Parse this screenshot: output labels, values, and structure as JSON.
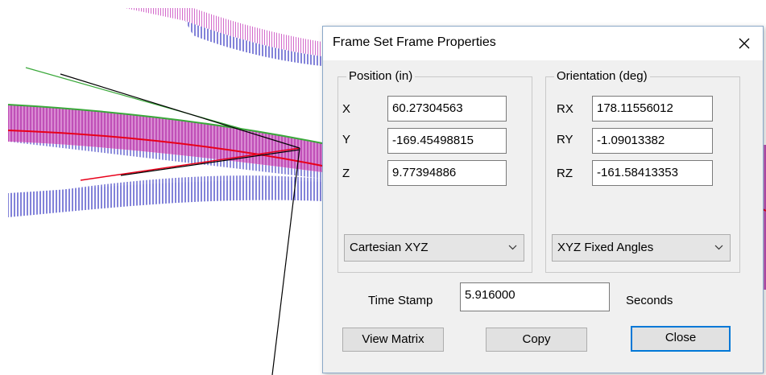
{
  "dialog": {
    "title": "Frame Set Frame Properties",
    "position_group": {
      "label": "Position (in)",
      "fields": [
        {
          "label": "X",
          "value": "60.27304563"
        },
        {
          "label": "Y",
          "value": "-169.45498815"
        },
        {
          "label": "Z",
          "value": "9.77394886"
        }
      ],
      "coord_system": "Cartesian XYZ"
    },
    "orientation_group": {
      "label": "Orientation (deg)",
      "fields": [
        {
          "label": "RX",
          "value": "178.11556012"
        },
        {
          "label": "RY",
          "value": "-1.09013382"
        },
        {
          "label": "RZ",
          "value": "-161.58413353"
        }
      ],
      "angle_convention": "XYZ Fixed Angles"
    },
    "time_stamp": {
      "label": "Time Stamp",
      "value": "5.916000",
      "unit": "Seconds"
    },
    "buttons": {
      "view_matrix": "View Matrix",
      "copy": "Copy",
      "close": "Close"
    }
  },
  "icons": [
    "close-icon",
    "chevron-down-icon"
  ],
  "colors": {
    "ribbon_fill": "#c44ab8",
    "ribbon_normals": "#3838c8",
    "frame_axis_red": "#e8001a",
    "frame_axis_green": "#3aa83a",
    "pointer_lines": "#000000",
    "default_button_border": "#0078d7"
  }
}
